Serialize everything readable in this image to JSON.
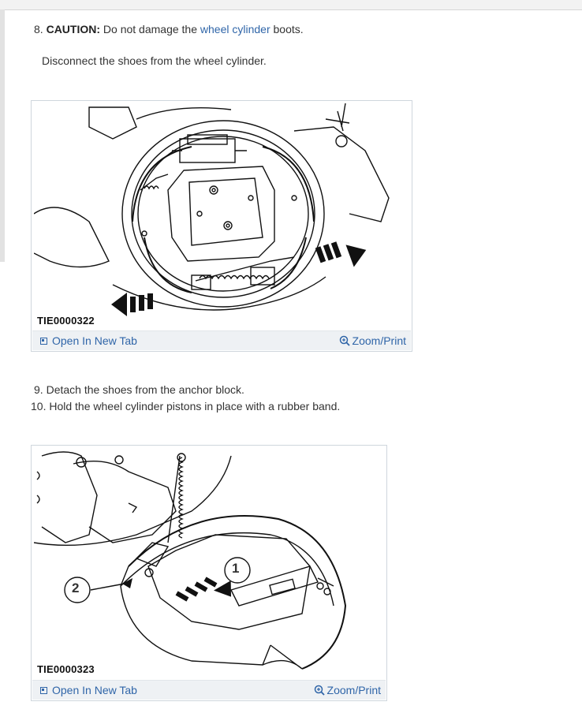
{
  "steps": {
    "step8": {
      "number": "8.",
      "caution_label": "CAUTION:",
      "text_before": " Do not damage the ",
      "link_text": "wheel cylinder",
      "text_after": " boots.",
      "subtext": "Disconnect the shoes from the wheel cylinder."
    },
    "step9": {
      "number": "9.",
      "text": "Detach the shoes from the anchor block."
    },
    "step10": {
      "number": "10.",
      "text": "Hold the wheel cylinder pistons in place with a rubber band."
    }
  },
  "figures": [
    {
      "caption": "TIE0000322",
      "open_label": "Open In New Tab",
      "zoom_label": "Zoom/Print"
    },
    {
      "caption": "TIE0000323",
      "open_label": "Open In New Tab",
      "zoom_label": "Zoom/Print",
      "callouts": [
        "1",
        "2"
      ]
    }
  ],
  "colors": {
    "link": "#2f65a8",
    "toolbar_bg": "#eef1f4"
  }
}
